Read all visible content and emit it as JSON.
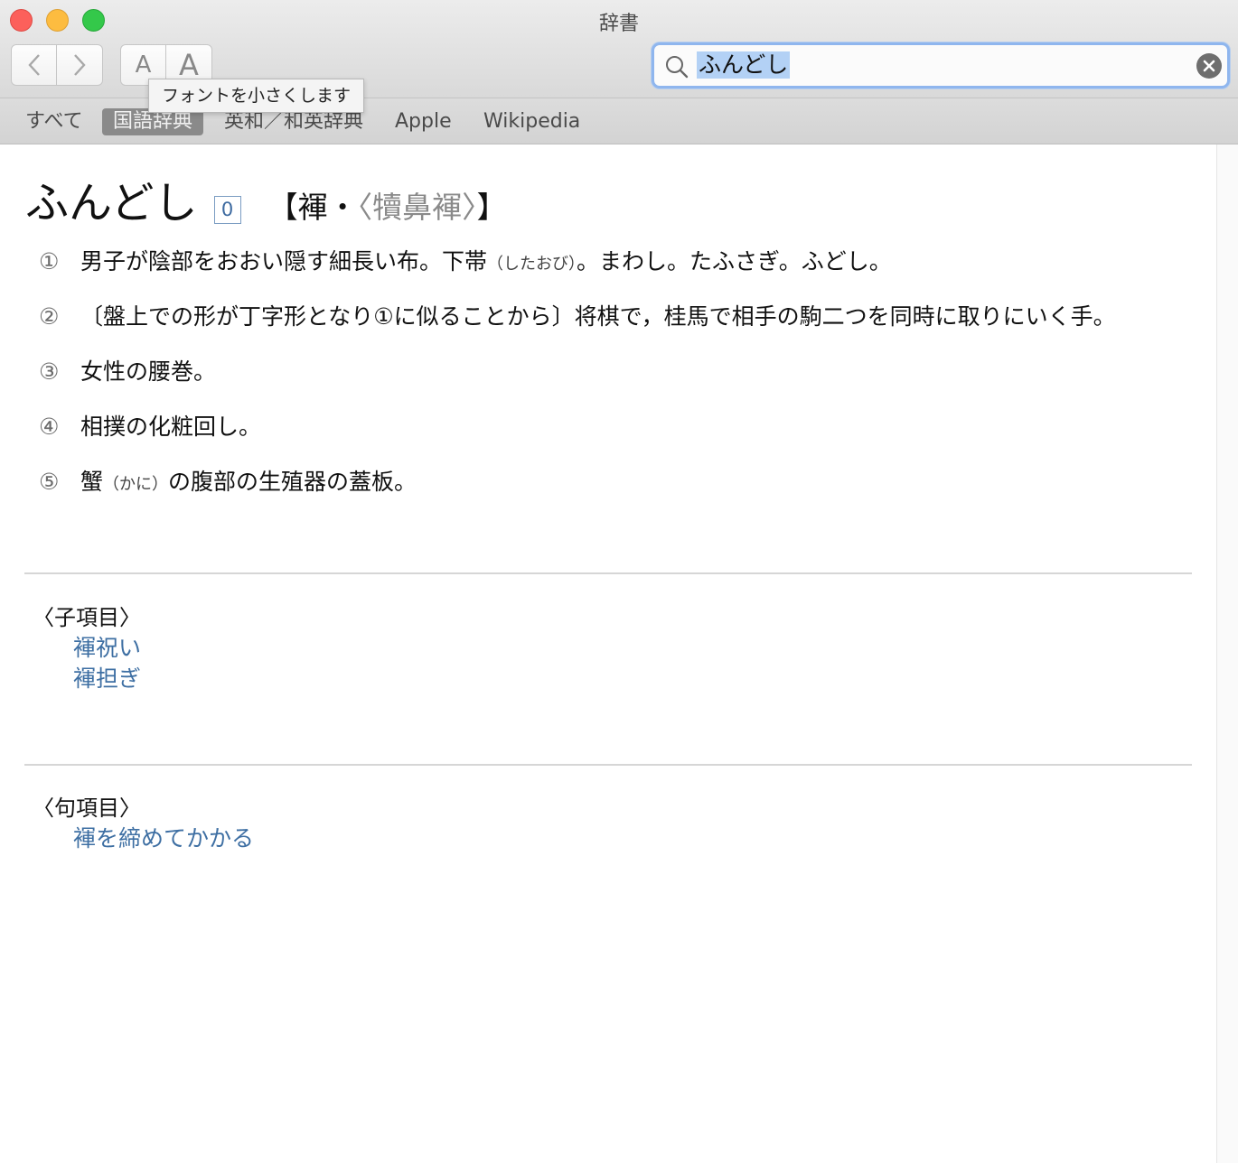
{
  "window": {
    "title": "辞書"
  },
  "toolbar": {
    "font_small_label": "A",
    "font_large_label": "A",
    "tooltip": "フォントを小さくします"
  },
  "search": {
    "value": "ふんどし"
  },
  "tabs": [
    {
      "label": "すべて",
      "active": false
    },
    {
      "label": "国語辞典",
      "active": true
    },
    {
      "label": "英和／和英辞典",
      "active": false
    },
    {
      "label": "Apple",
      "active": false
    },
    {
      "label": "Wikipedia",
      "active": false
    }
  ],
  "entry": {
    "headword": "ふんどし",
    "accent": "0",
    "kanji_open": "【褌・",
    "kanji_alt": "〈犢鼻褌〉",
    "kanji_close": "】",
    "senses": [
      {
        "num": "①",
        "pre": "男子が陰部をおおい隠す細長い布。下帯",
        "ruby": "（したおび）",
        "post": "。まわし。たふさぎ。ふどし。"
      },
      {
        "num": "②",
        "pre": "〔盤上での形が丁字形となり①に似ることから〕将棋で，桂馬で相手の駒二つを同時に取りにいく手。",
        "ruby": "",
        "post": ""
      },
      {
        "num": "③",
        "pre": "女性の腰巻。",
        "ruby": "",
        "post": ""
      },
      {
        "num": "④",
        "pre": "相撲の化粧回し。",
        "ruby": "",
        "post": ""
      },
      {
        "num": "⑤",
        "pre": "蟹",
        "ruby": "（かに）",
        "post": "の腹部の生殖器の蓋板。"
      }
    ]
  },
  "subentries": {
    "heading": "〈子項目〉",
    "items": [
      "褌祝い",
      "褌担ぎ"
    ]
  },
  "phrases": {
    "heading": "〈句項目〉",
    "items": [
      "褌を締めてかかる"
    ]
  },
  "colors": {
    "link": "#3e6fa3",
    "search_highlight": "#b3d1f5",
    "tab_active": "#8a8a8a"
  }
}
